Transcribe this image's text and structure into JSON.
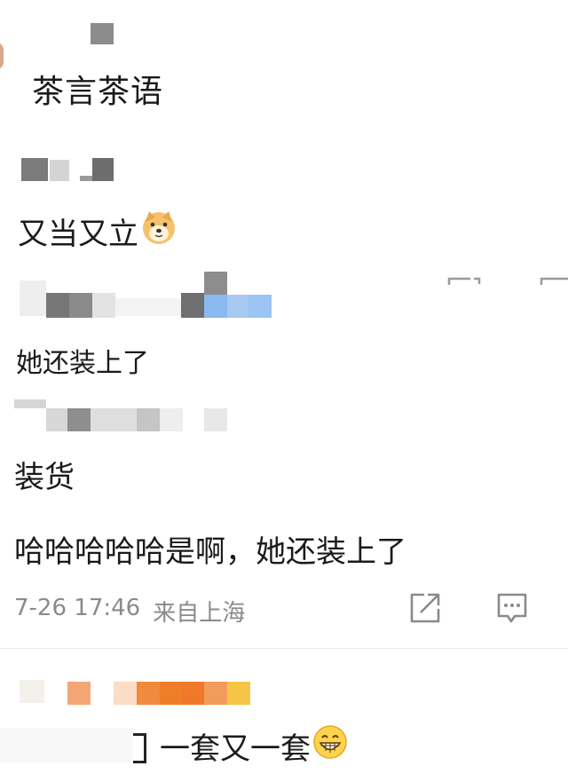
{
  "comments": [
    {
      "content": "茶言茶语"
    },
    {
      "content": "又当又立",
      "emoji": "doge-emoji"
    },
    {
      "content": "她还装上了"
    },
    {
      "content": "装货"
    },
    {
      "content": "哈哈哈哈哈是啊，她还装上了",
      "timestamp": "7-26 17:46",
      "location": "来自上海"
    },
    {
      "content": "一套又一套",
      "emoji": "grin-emoji"
    }
  ],
  "icons": {
    "share": "share-icon",
    "comment": "comment-icon"
  }
}
